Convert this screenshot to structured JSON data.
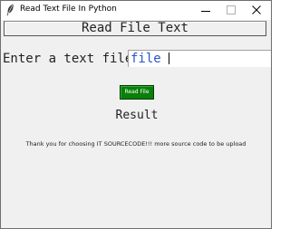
{
  "window": {
    "title": "Read Text File In Python",
    "icons": {
      "app": "feather-icon",
      "minimize": "minimize-icon",
      "maximize": "maximize-icon",
      "close": "close-icon"
    }
  },
  "header": {
    "title": "Read File Text"
  },
  "form": {
    "prompt_label": "Enter a text file",
    "file_input_value": "file",
    "button_label": "Read File"
  },
  "result": {
    "label": "Result"
  },
  "footer": {
    "text": "Thank you for choosing IT SOURCECODE!!! more source code to be upload"
  },
  "colors": {
    "background": "#f0f0f0",
    "button_bg": "#0a7f0a",
    "button_text": "#ffffff",
    "input_text": "#2a56c6"
  }
}
